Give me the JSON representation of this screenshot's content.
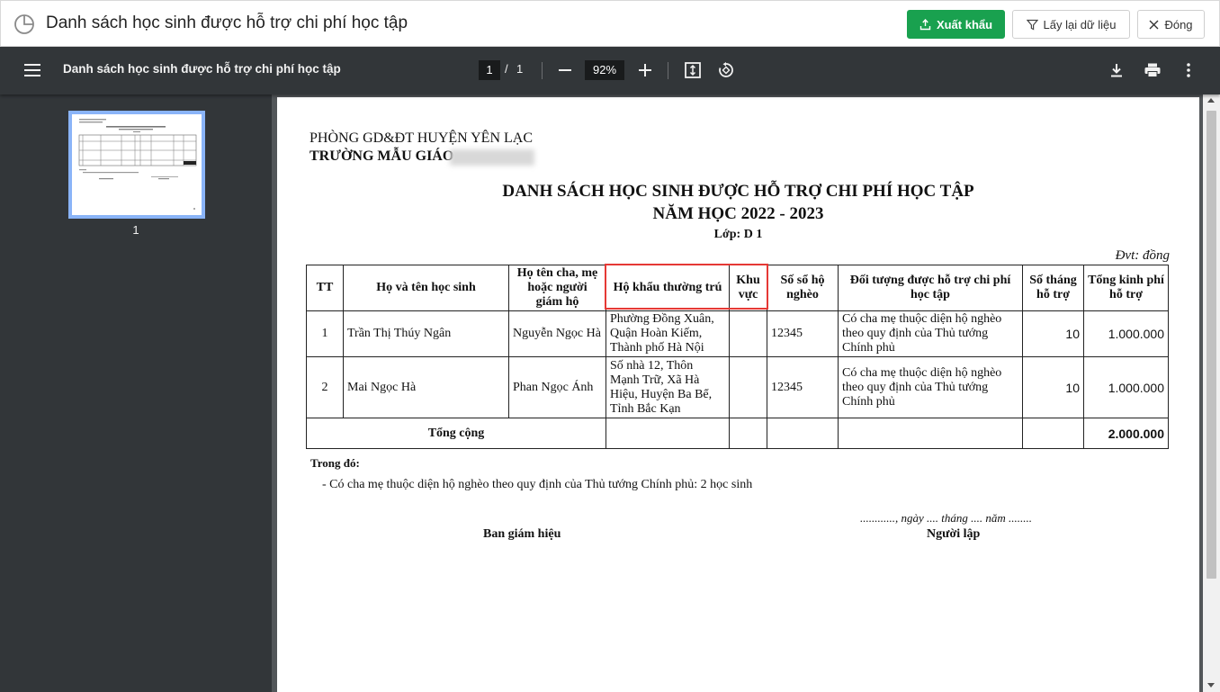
{
  "app": {
    "title": "Danh sách học sinh được hỗ trợ chi phí học tập",
    "export_label": "Xuất khẩu",
    "reload_label": "Lấy lại dữ liệu",
    "close_label": "Đóng",
    "accent_color": "#19a14f"
  },
  "viewer": {
    "doc_title": "Danh sách học sinh được hỗ trợ chi phí học tập",
    "current_page": "1",
    "page_separator": "/",
    "total_pages": "1",
    "zoom": "92%",
    "thumbnail_label": "1"
  },
  "document": {
    "org_line1": "PHÒNG GD&ĐT HUYỆN YÊN LẠC",
    "org_line2": "TRƯỜNG MẪU GIÁO",
    "title_line1": "DANH SÁCH HỌC SINH ĐƯỢC HỖ TRỢ CHI PHÍ HỌC TẬP",
    "title_line2": "NĂM HỌC 2022 - 2023",
    "class_label": "Lớp: D 1",
    "unit_note": "Đvt: đồng",
    "columns": {
      "tt": "TT",
      "student_name": "Họ và tên học sinh",
      "guardian": "Họ tên cha, mẹ hoặc người giám hộ",
      "residence": "Hộ khẩu thường trú",
      "area": "Khu vực",
      "poverty_book": "Số sổ hộ nghèo",
      "beneficiary_type": "Đối tượng được hỗ trợ chi phí học tập",
      "months": "Số tháng hỗ trợ",
      "total_cost": "Tổng kinh phí hỗ trợ"
    },
    "rows": [
      {
        "tt": "1",
        "student_name": "Trần Thị Thúy Ngân",
        "guardian": "Nguyễn Ngọc Hà",
        "residence": "Phường Đồng Xuân, Quận Hoàn Kiếm, Thành phố Hà Nội",
        "area": "",
        "poverty_book": "12345",
        "beneficiary_type": "Có cha mẹ thuộc diện hộ nghèo theo quy định của Thủ tướng Chính phủ",
        "months": "10",
        "total_cost": "1.000.000"
      },
      {
        "tt": "2",
        "student_name": "Mai Ngọc Hà",
        "guardian": "Phan Ngọc Ánh",
        "residence": "Số nhà 12, Thôn Mạnh Trữ, Xã Hà Hiệu, Huyện Ba Bể, Tỉnh Bắc Kạn",
        "area": "",
        "poverty_book": "12345",
        "beneficiary_type": "Có cha mẹ thuộc diện hộ nghèo theo quy định của Thủ tướng Chính phủ",
        "months": "10",
        "total_cost": "1.000.000"
      }
    ],
    "total_label": "Tổng cộng",
    "total_value": "2.000.000",
    "summary_heading": "Trong đó:",
    "summary_line": "- Có cha mẹ thuộc diện hộ nghèo theo quy định của Thủ tướng Chính phủ: 2 học sinh",
    "sign_left": "Ban giám hiệu",
    "sign_date": "............, ngày .... tháng .... năm ........",
    "sign_right": "Người lập",
    "highlight_color": "#e53935"
  }
}
